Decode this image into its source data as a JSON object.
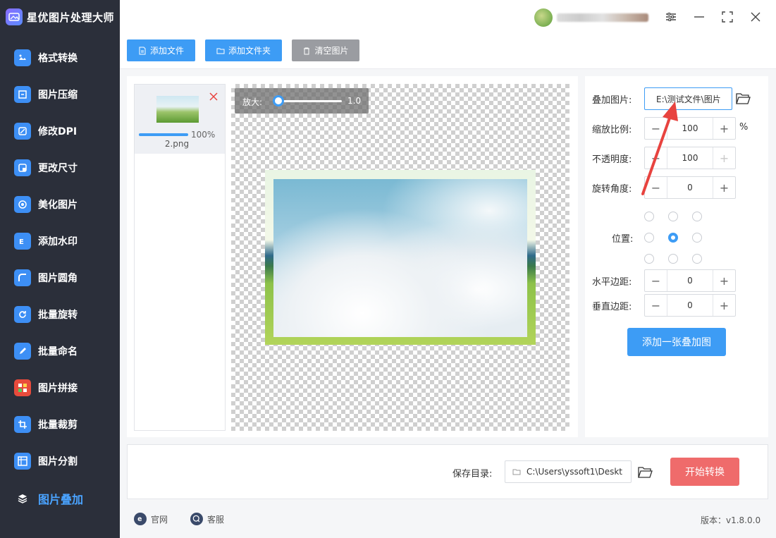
{
  "app": {
    "title": "星优图片处理大师"
  },
  "sidebar": {
    "items": [
      {
        "label": "格式转换",
        "icon": "format-convert-icon",
        "color": "#3d8ff5"
      },
      {
        "label": "图片压缩",
        "icon": "compress-icon",
        "color": "#3d8ff5"
      },
      {
        "label": "修改DPI",
        "icon": "dpi-icon",
        "color": "#3d8ff5"
      },
      {
        "label": "更改尺寸",
        "icon": "resize-icon",
        "color": "#3d8ff5"
      },
      {
        "label": "美化图片",
        "icon": "beautify-icon",
        "color": "#3d8ff5"
      },
      {
        "label": "添加水印",
        "icon": "watermark-icon",
        "color": "#3d8ff5"
      },
      {
        "label": "图片圆角",
        "icon": "round-corner-icon",
        "color": "#3d8ff5"
      },
      {
        "label": "批量旋转",
        "icon": "rotate-icon",
        "color": "#3d8ff5"
      },
      {
        "label": "批量命名",
        "icon": "rename-icon",
        "color": "#3d8ff5"
      },
      {
        "label": "图片拼接",
        "icon": "stitch-icon",
        "color": "#e84b3c"
      },
      {
        "label": "批量裁剪",
        "icon": "crop-icon",
        "color": "#3d8ff5"
      },
      {
        "label": "图片分割",
        "icon": "split-icon",
        "color": "#3d8ff5"
      },
      {
        "label": "图片叠加",
        "icon": "layers-icon",
        "color": "#4aa3ff",
        "active": true
      }
    ]
  },
  "toolbar": {
    "add_file": "添加文件",
    "add_folder": "添加文件夹",
    "clear_images": "清空图片"
  },
  "file_list": {
    "items": [
      {
        "name": "2.png",
        "progress_text": "100%",
        "progress": 1.0
      }
    ]
  },
  "preview": {
    "zoom_label": "放大:",
    "zoom_value": "1.0"
  },
  "settings": {
    "overlay_label": "叠加图片:",
    "overlay_path": "E:\\测试文件\\图片",
    "scale_label": "缩放比例:",
    "scale_value": "100",
    "scale_unit": "%",
    "opacity_label": "不透明度:",
    "opacity_value": "100",
    "rotation_label": "旋转角度:",
    "rotation_value": "0",
    "position_label": "位置:",
    "position_selected": "center",
    "h_margin_label": "水平边距:",
    "h_margin_value": "0",
    "v_margin_label": "垂直边距:",
    "v_margin_value": "0",
    "add_overlay_button": "添加一张叠加图"
  },
  "output": {
    "save_dir_label": "保存目录:",
    "save_dir_value": "C:\\Users\\yssoft1\\Deskt",
    "start_button": "开始转换"
  },
  "footer": {
    "website": "官网",
    "support": "客服",
    "version": "版本：v1.8.0.0"
  },
  "colors": {
    "sidebar_bg": "#2b2f3a",
    "accent": "#3d9cf5",
    "start_button": "#ef6b6b",
    "annotation_arrow": "#e8433f"
  }
}
